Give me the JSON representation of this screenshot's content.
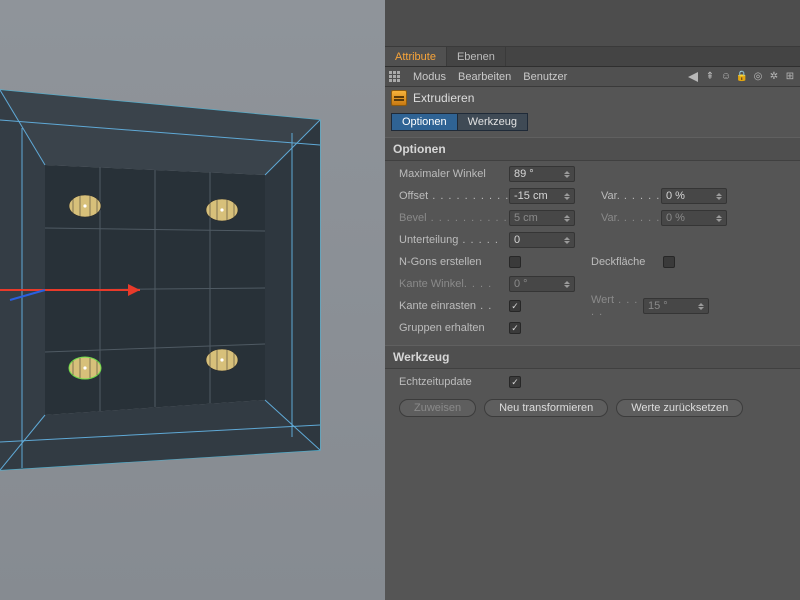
{
  "tabs": {
    "attribute": "Attribute",
    "ebenen": "Ebenen"
  },
  "menu": {
    "modus": "Modus",
    "bearbeiten": "Bearbeiten",
    "benutzer": "Benutzer"
  },
  "tool": {
    "name": "Extrudieren"
  },
  "subtabs": {
    "optionen": "Optionen",
    "werkzeug": "Werkzeug"
  },
  "sections": {
    "optionen": "Optionen",
    "werkzeug": "Werkzeug"
  },
  "labels": {
    "max_winkel": "Maximaler Winkel",
    "offset": "Offset",
    "bevel": "Bevel",
    "unterteilung": "Unterteilung",
    "ngons": "N-Gons erstellen",
    "kante_winkel": "Kante Winkel",
    "kante_einrasten": "Kante einrasten",
    "gruppen": "Gruppen erhalten",
    "echtzeit": "Echtzeitupdate",
    "var": "Var.",
    "deckflaeche": "Deckfläche",
    "wert": "Wert"
  },
  "values": {
    "max_winkel": "89 °",
    "offset": "-15 cm",
    "bevel": "5 cm",
    "unterteilung": "0",
    "var1": "0 %",
    "var2": "0 %",
    "kante_winkel": "0 °",
    "wert": "15 °",
    "ngons_checked": "",
    "deck_checked": "",
    "einrasten_checked": "✓",
    "gruppen_checked": "✓",
    "echtzeit_checked": "✓"
  },
  "buttons": {
    "zuweisen": "Zuweisen",
    "neu": "Neu transformieren",
    "reset": "Werte zurücksetzen"
  }
}
